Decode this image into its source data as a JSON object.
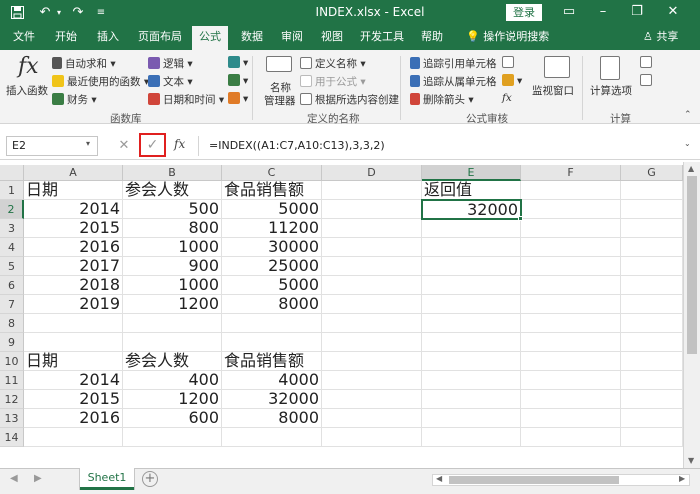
{
  "app": {
    "title": "INDEX.xlsx  -  Excel",
    "login_label": "登录",
    "share_label": "共享",
    "tell_me": "操作说明搜索"
  },
  "colors": {
    "accent": "#217346",
    "highlight": "#e0201f"
  },
  "ribbon_tabs": [
    "文件",
    "开始",
    "插入",
    "页面布局",
    "公式",
    "数据",
    "审阅",
    "视图",
    "开发工具",
    "帮助"
  ],
  "active_tab": "公式",
  "ribbon": {
    "insert_function": "插入函数",
    "autosum": "自动求和",
    "recent": "最近使用的函数",
    "financial": "财务",
    "logical": "逻辑",
    "text": "文本",
    "datetime": "日期和时间",
    "function_library": "函数库",
    "name_manager_1": "名称",
    "name_manager_2": "管理器",
    "define_name": "定义名称",
    "use_in_formula": "用于公式",
    "create_from_selection": "根据所选内容创建",
    "defined_names": "定义的名称",
    "trace_precedents": "追踪引用单元格",
    "trace_dependents": "追踪从属单元格",
    "remove_arrows": "删除箭头",
    "formula_auditing": "公式审核",
    "watch_window": "监视窗口",
    "calc_options": "计算选项",
    "calculation": "计算"
  },
  "formula_bar": {
    "name_box": "E2",
    "formula": "=INDEX((A1:C7,A10:C13),3,3,2)",
    "fx_label": "fx"
  },
  "columns": [
    "A",
    "B",
    "C",
    "D",
    "E",
    "F",
    "G"
  ],
  "rows": [
    "1",
    "2",
    "3",
    "4",
    "5",
    "6",
    "7",
    "8",
    "9",
    "10",
    "11",
    "12",
    "13",
    "14"
  ],
  "cells": {
    "A1": "日期",
    "B1": "参会人数",
    "C1": "食品销售额",
    "E1": "返回值",
    "A2": "2014",
    "B2": "500",
    "C2": "5000",
    "E2": "32000",
    "A3": "2015",
    "B3": "800",
    "C3": "11200",
    "A4": "2016",
    "B4": "1000",
    "C4": "30000",
    "A5": "2017",
    "B5": "900",
    "C5": "25000",
    "A6": "2018",
    "B6": "1000",
    "C6": "5000",
    "A7": "2019",
    "B7": "1200",
    "C7": "8000",
    "A10": "日期",
    "B10": "参会人数",
    "C10": "食品销售额",
    "A11": "2014",
    "B11": "400",
    "C11": "4000",
    "A12": "2015",
    "B12": "1200",
    "C12": "32000",
    "A13": "2016",
    "B13": "600",
    "C13": "8000"
  },
  "sheet_tabs": [
    "Sheet1"
  ]
}
